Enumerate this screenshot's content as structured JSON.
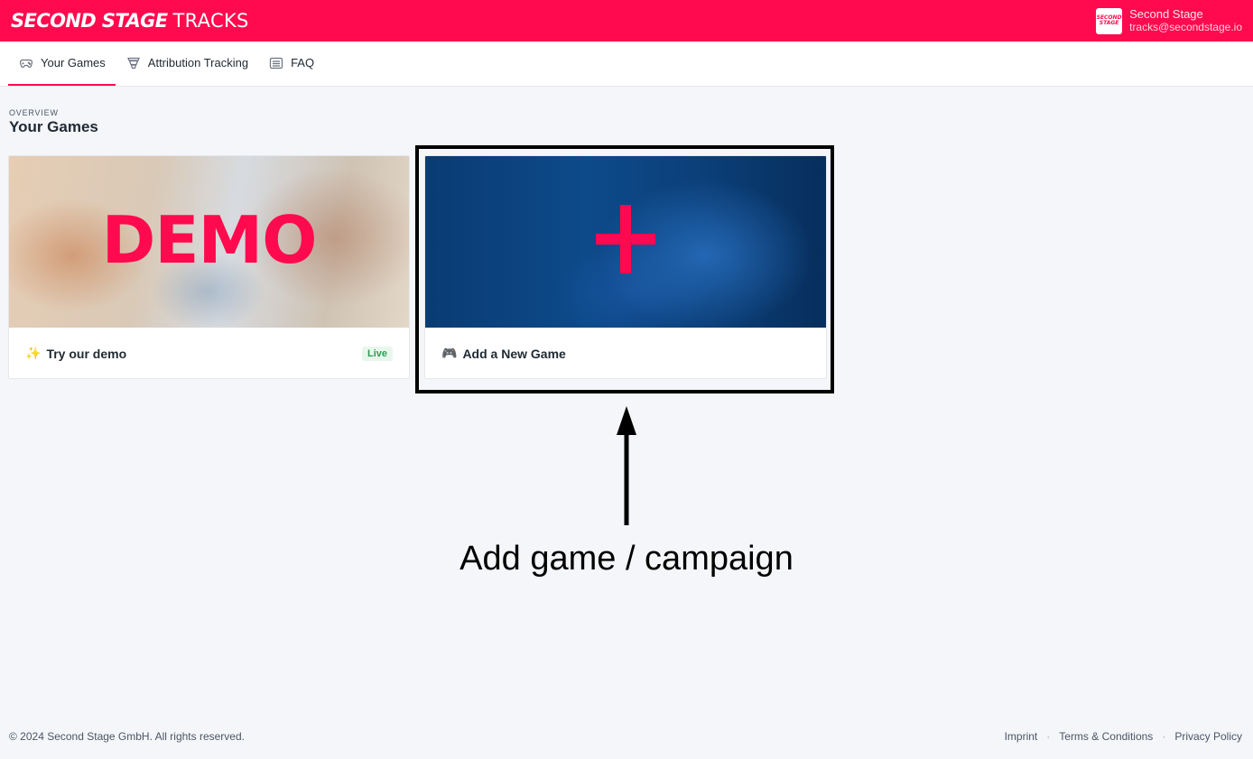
{
  "header": {
    "brand_strong": "SECOND STAGE",
    "brand_light": "TRACKS",
    "account_name": "Second Stage",
    "account_email": "tracks@secondstage.io",
    "logo_line1": "SECOND",
    "logo_line2": "STAGE",
    "brand_color": "#ff0a4e"
  },
  "nav": {
    "items": [
      {
        "label": "Your Games",
        "icon": "gamepad-icon",
        "active": true
      },
      {
        "label": "Attribution Tracking",
        "icon": "funnel-icon",
        "active": false
      },
      {
        "label": "FAQ",
        "icon": "list-icon",
        "active": false
      }
    ]
  },
  "main": {
    "overline": "OVERVIEW",
    "title": "Your Games",
    "cards": [
      {
        "image_text": "DEMO",
        "emoji": "✨",
        "title": "Try our demo",
        "badge": "Live"
      },
      {
        "image_icon": "plus-icon",
        "emoji": "🎮",
        "title": "Add a New Game"
      }
    ]
  },
  "annotation": {
    "text": "Add game / campaign"
  },
  "footer": {
    "copyright": "© 2024 Second Stage GmbH. All rights reserved.",
    "links": [
      "Imprint",
      "Terms & Conditions",
      "Privacy Policy"
    ],
    "separator": "·"
  }
}
